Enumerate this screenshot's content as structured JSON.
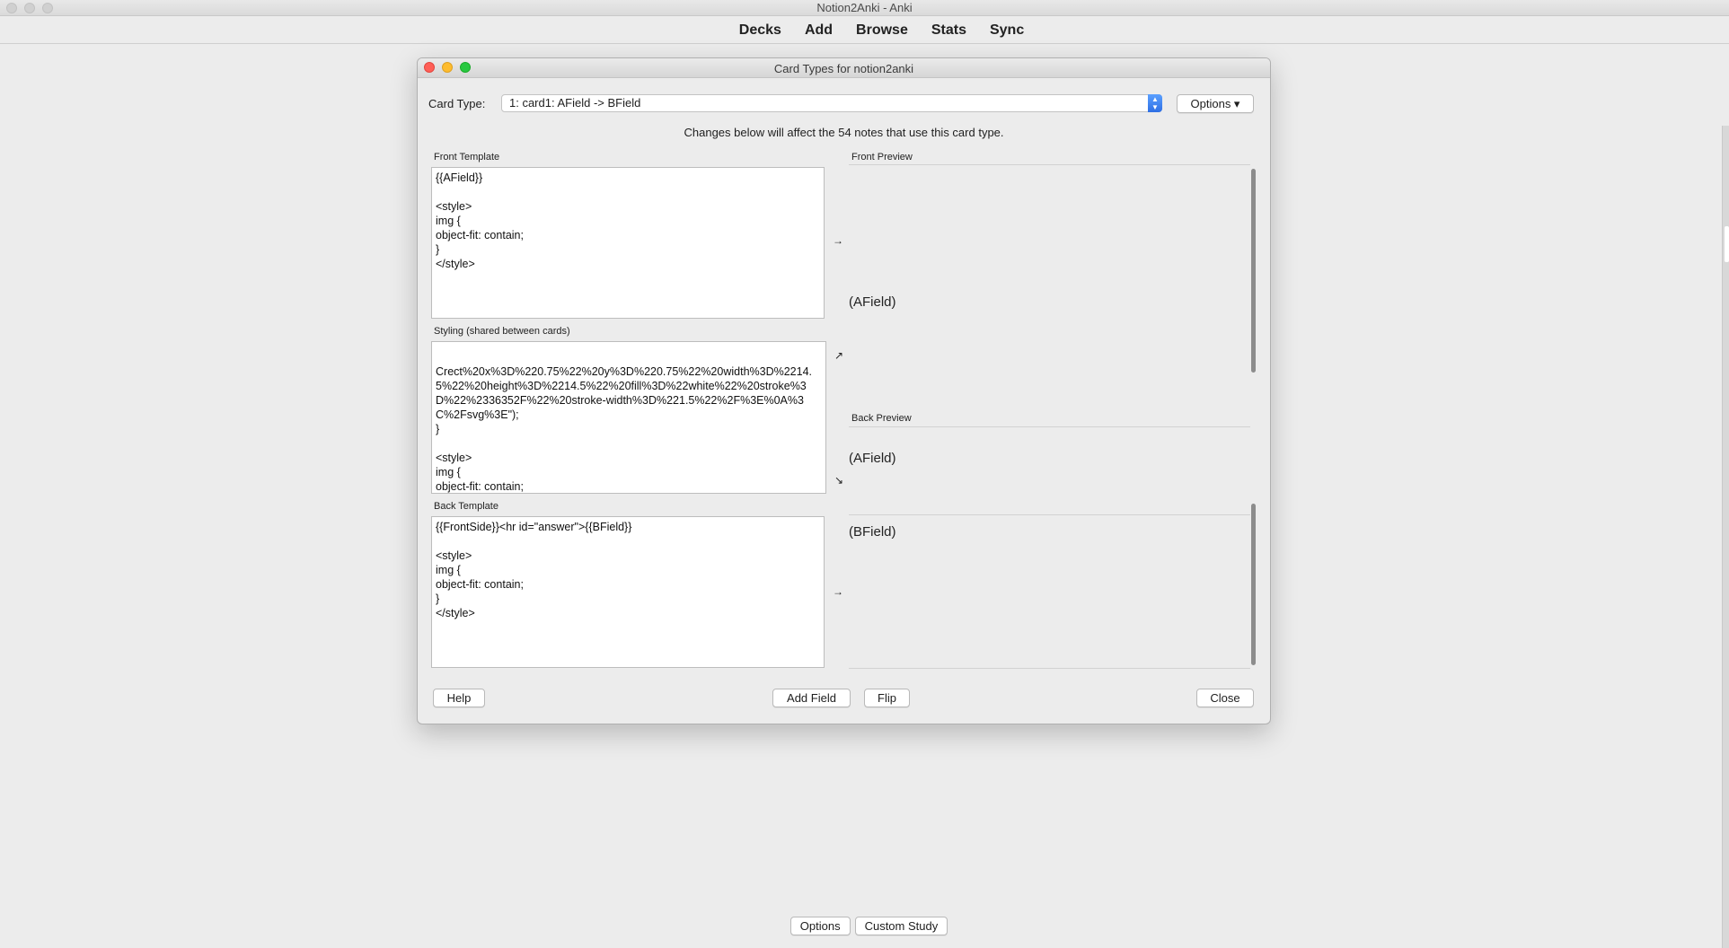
{
  "app": {
    "window_title": "Notion2Anki - Anki",
    "nav": [
      "Decks",
      "Add",
      "Browse",
      "Stats",
      "Sync"
    ],
    "bottom_buttons": {
      "options": "Options",
      "custom_study": "Custom Study"
    }
  },
  "dialog": {
    "title": "Card Types for notion2anki",
    "card_type_label": "Card Type:",
    "card_type_value": "1: card1: AField -> BField",
    "options_button": "Options ▾",
    "notice": "Changes below will affect the 54 notes that use this card type.",
    "front_template": {
      "label": "Front Template",
      "content": "{{AField}}\n\n<style>\nimg {\nobject-fit: contain;\n}\n</style>"
    },
    "styling": {
      "label": "Styling (shared between cards)",
      "content": "Crect%20x%3D%220.75%22%20y%3D%220.75%22%20width%3D%2214.5%22%20height%3D%2214.5%22%20fill%3D%22white%22%20stroke%3D%22%2336352F%22%20stroke-width%3D%221.5%22%2F%3E%0A%3C%2Fsvg%3E\");\n}\n\n<style>\nimg {\nobject-fit: contain;\n}\n</style>"
    },
    "back_template": {
      "label": "Back Template",
      "content": "{{FrontSide}}<hr id=\"answer\">{{BField}}\n\n<style>\nimg {\nobject-fit: contain;\n}\n</style>"
    },
    "front_preview": {
      "label": "Front Preview",
      "text": "(AField)"
    },
    "back_preview": {
      "label": "Back Preview",
      "text_front": "(AField)",
      "text_back": "(BField)"
    },
    "arrows": {
      "right": "→",
      "up_right": "↗",
      "down_right": "↘"
    },
    "buttons": {
      "help": "Help",
      "add_field": "Add Field",
      "flip": "Flip",
      "close": "Close"
    }
  },
  "colors": {
    "close_dot": "#ff5f57",
    "minimize_dot": "#febc2e",
    "zoom_dot": "#28c840",
    "stepper_accent": "#2f6fe4"
  }
}
